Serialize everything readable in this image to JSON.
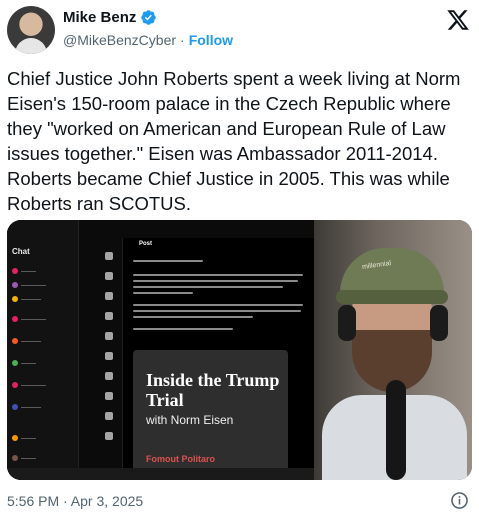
{
  "author": {
    "name": "Mike Benz",
    "handle": "@MikeBenzCyber",
    "follow_label": "Follow",
    "separator": "·"
  },
  "tweet": {
    "text": "Chief Justice John Roberts spent a week living at Norm Eisen's 150-room palace in the Czech Republic where they \"worked on American and European Rule of Law issues together.\" Eisen was Ambassador 2011-2014. Roberts became Chief Justice in 2005. This was while Roberts ran SCOTUS.",
    "timestamp": "5:56 PM · Apr 3, 2025"
  },
  "media": {
    "chat_title": "Chat",
    "post_label": "Post",
    "book_title": "Inside the Trump Trial",
    "book_subtitle": "with Norm Eisen",
    "book_footer": "Fomout Politaro",
    "cap_text": "millennial"
  },
  "icons": {
    "verified": "verified-badge-icon",
    "x_logo": "x-logo-icon",
    "info": "info-icon"
  },
  "colors": {
    "link": "#1d9bf0",
    "verified": "#1d9bf0",
    "muted": "#536471"
  }
}
